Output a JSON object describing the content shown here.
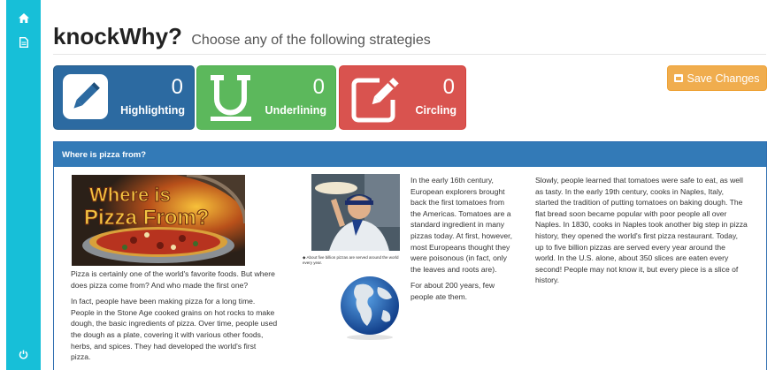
{
  "sidebar": {
    "items": [
      {
        "icon": "home-icon"
      },
      {
        "icon": "document-icon"
      },
      {
        "icon": "power-icon"
      }
    ],
    "accent": "#17bfd8"
  },
  "header": {
    "title": "knockWhy?",
    "subtitle": "Choose any of the following strategies"
  },
  "strategies": [
    {
      "count": "0",
      "label": "Highlighting",
      "icon": "pencil-icon",
      "color": "#2c6aa1"
    },
    {
      "count": "0",
      "label": "Underlining",
      "icon": "underline-icon",
      "color": "#5cb85c"
    },
    {
      "count": "0",
      "label": "Circling",
      "icon": "edit-icon",
      "color": "#d9534f"
    }
  ],
  "save_button": {
    "label": "Save Changes",
    "icon": "floppy-icon",
    "color": "#f0ad4e"
  },
  "panel": {
    "heading": "Where is pizza from?",
    "image_caption": "About five billion pizzas are served around the world every year.",
    "col1": [
      "Pizza is certainly one of the world's favorite foods. But where does pizza come from? And who made the first one?",
      "In fact, people have been making pizza for a long time. People in the Stone Age cooked grains on hot rocks to make dough, the basic ingredients of pizza. Over time, people used the dough as a plate, covering it with various other foods, herbs, and spices. They had developed the world's first pizza."
    ],
    "col2": [
      "In the early 16th century, European explorers brought back the first tomatoes from the Americas. Tomatoes are a standard ingredient in many pizzas today. At first, however, most Europeans thought they were poisonous (in fact, only the leaves and roots are).",
      "For about 200 years, few people ate them."
    ],
    "col3": [
      "Slowly, people learned that tomatoes were safe to eat, as well as tasty. In the early 19th century, cooks in Naples, Italy, started the tradition of putting tomatoes on baking dough. The flat bread soon became popular with poor people all over Naples. In 1830, cooks in Naples took another big step in pizza history, they opened the world's first pizza restaurant. Today, up to five billion pizzas are served every year around the world. In the U.S. alone, about 350 slices are eaten every second! People may not know it, but every piece is a slice of history."
    ]
  }
}
